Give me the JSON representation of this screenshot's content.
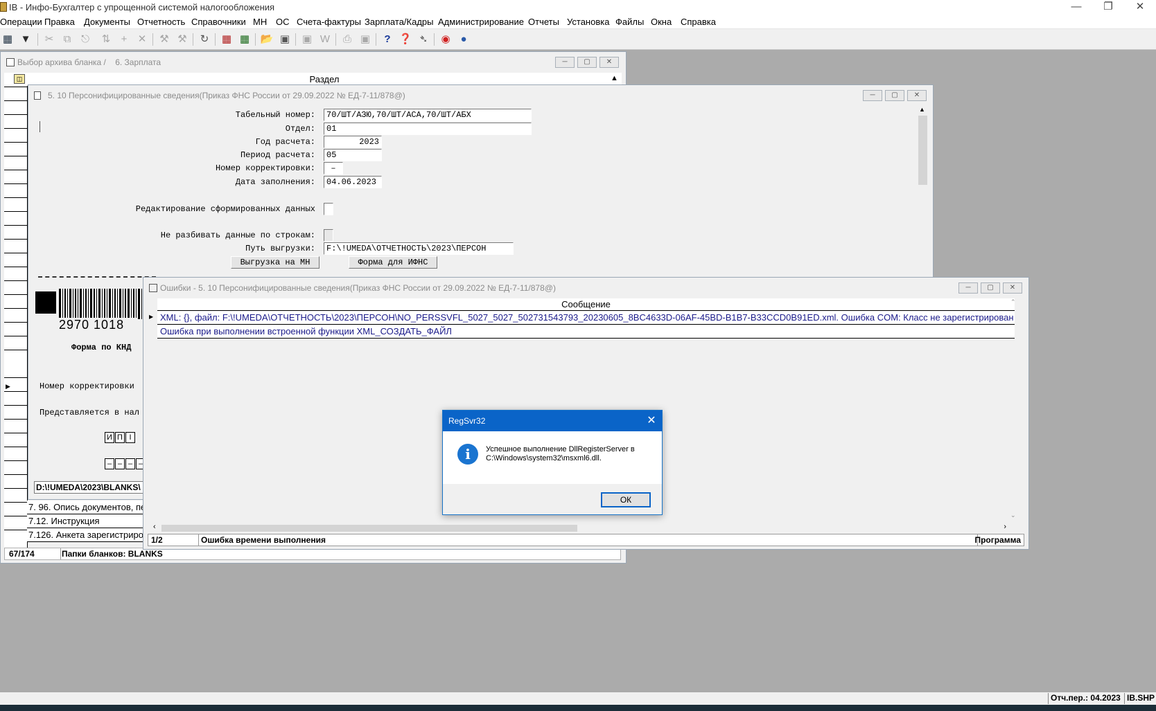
{
  "app": {
    "title": "IB - Инфо-Бухгалтер с упрощенной системой налогообложения"
  },
  "menu": [
    "Операции",
    "Правка",
    "Документы",
    "Отчетность",
    "Справочники",
    "МН",
    "ОС",
    "Счета-фактуры",
    "Зарплата/Кадры",
    "Администрирование",
    "Отчеты",
    "Установка",
    "Файлы",
    "Окна",
    "Справка"
  ],
  "toolbar_icons": [
    "grid-icon",
    "filter-icon",
    "cut-icon",
    "copy-icon",
    "paste-icon",
    "sort-icon",
    "add-icon",
    "delete-icon",
    "tools-icon",
    "tools2-icon",
    "refresh-icon",
    "report-icon",
    "calculator-icon",
    "open-folder-icon",
    "save-icon",
    "export-icon",
    "word-icon",
    "print-icon",
    "preview-icon",
    "help-icon",
    "context-help-icon",
    "navigator-icon",
    "lifebuoy-icon",
    "globe-icon"
  ],
  "archive_window": {
    "title": "Выбор архива бланка /",
    "subtitle": "6. Зарплата",
    "column_header": "Раздел",
    "rows": [
      "7. 96. Опись документов, пе",
      "7.12.      Инструкция",
      "7.126. Анкета зарегистриров"
    ],
    "status_count": "67/174",
    "status_text": "Папки бланков: BLANKS"
  },
  "person_window": {
    "title": "5. 10 Персонифицированные сведения(Приказ ФНС России от 29.09.2022 № ЕД-7-11/878@)",
    "fields": {
      "tab_label": "Табельный номер:",
      "tab_value": "70/ШТ/АЗЮ,70/ШТ/АСА,70/ШТ/АБХ",
      "dept_label": "Отдел:",
      "dept_value": "01",
      "year_label": "Год расчета:",
      "year_value": "2023",
      "period_label": "Период расчета:",
      "period_value": "05",
      "corr_label": "Номер корректировки:",
      "corr_value": "–",
      "date_label": "Дата заполнения:",
      "date_value": "04.06.2023",
      "edit_label": "Редактирование сформированных данных",
      "split_label": "Не разбивать данные по строкам:",
      "path_label": "Путь выгрузки:",
      "path_value": "F:\\!UMEDA\\ОТЧЕТНОСТЬ\\2023\\ПЕРСОН"
    },
    "btn_mn": "Выгрузка на МН",
    "btn_ifns": "Форма для ИФНС",
    "barcode_number": "2970 1018",
    "form_knd": "Форма по КНД",
    "corr_text": "Номер корректировки",
    "present_text": "Представляется в нал",
    "boxes_letters": [
      "И",
      "П",
      "I"
    ],
    "boxes_dashes": [
      "–",
      "–",
      "–",
      "–"
    ],
    "blank_path": "D:\\!UMEDA\\2023\\BLANKS\\"
  },
  "errors_window": {
    "title": "Ошибки - 5. 10 Персонифицированные сведения(Приказ ФНС России от 29.09.2022 № ЕД-7-11/878@)",
    "column_header": "Сообщение",
    "rows": [
      "XML: {}, файл: F:\\!UMEDA\\ОТЧЕТНОСТЬ\\2023\\ПЕРСОН\\NO_PERSSVFL_5027_5027_502731543793_20230605_8BC4633D-06AF-45BD-B1B7-B33CCD0B91ED.xml. Ошибка COM: Класс не зарегистрирован",
      "Ошибка при выполнении встроенной функции XML_СОЗДАТЬ_ФАЙЛ"
    ],
    "status_count": "1/2",
    "status_text": "Ошибка времени выполнения",
    "status_right": "Программа"
  },
  "dialog": {
    "title": "RegSvr32",
    "message_line1": "Успешное выполнение DllRegisterServer в",
    "message_line2": "C:\\Windows\\system32\\msxml6.dll.",
    "ok": "ОК"
  },
  "bottom_status": {
    "period": "Отч.пер.: 04.2023",
    "file": "IB.SHP"
  },
  "colors": {
    "dialog_title": "#0a64c8",
    "error_text": "#1a1a8a",
    "desktop": "#ababab"
  }
}
